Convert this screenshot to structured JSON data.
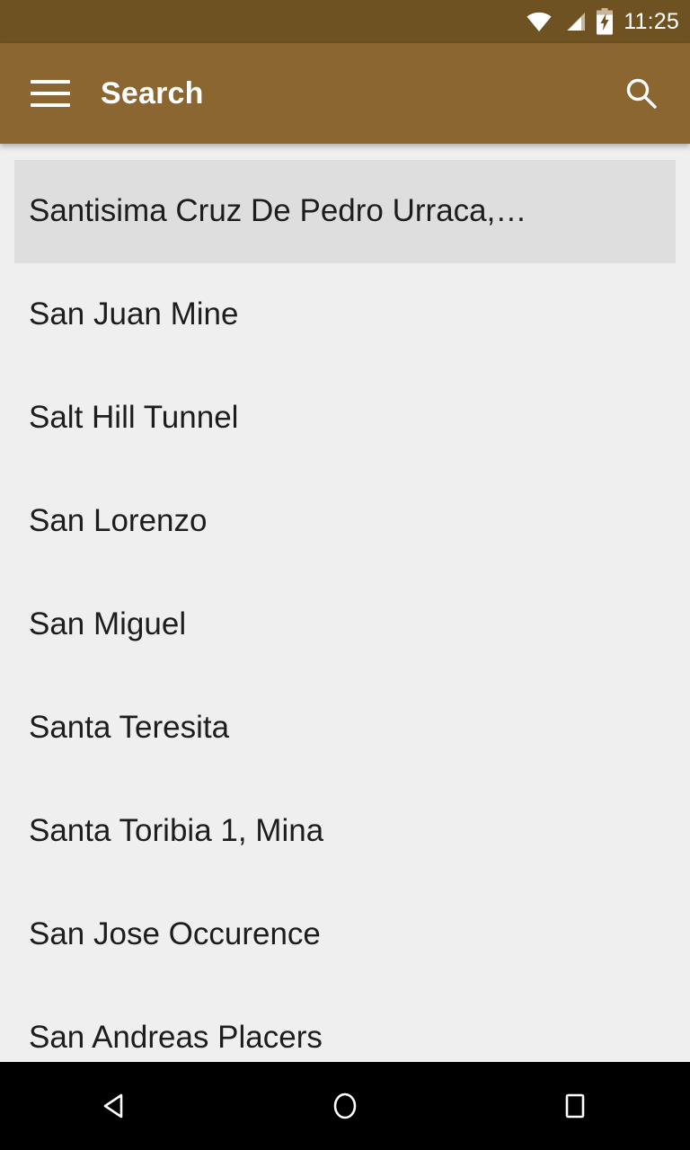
{
  "status_bar": {
    "time": "11:25",
    "icons": [
      {
        "name": "wifi-icon",
        "label": "wifi"
      },
      {
        "name": "cell-signal-icon",
        "label": "signal"
      },
      {
        "name": "battery-charging-icon",
        "label": "battery charging"
      }
    ],
    "background_color": "#6E5222"
  },
  "app_bar": {
    "menu_icon": "hamburger-menu-icon",
    "title": "Search",
    "search_icon": "search-icon",
    "background_color": "#8C6630",
    "text_color": "#FFFFFF"
  },
  "list": {
    "background_color": "#EFEFEF",
    "selected_color": "#DEDEDE",
    "text_color": "#1D1D1D",
    "items": [
      {
        "label": "Santisima Cruz De Pedro Urraca,…",
        "selected": true
      },
      {
        "label": "San Juan Mine",
        "selected": false
      },
      {
        "label": "Salt Hill Tunnel",
        "selected": false
      },
      {
        "label": "San Lorenzo",
        "selected": false
      },
      {
        "label": "San Miguel",
        "selected": false
      },
      {
        "label": "Santa Teresita",
        "selected": false
      },
      {
        "label": "Santa Toribia 1, Mina",
        "selected": false
      },
      {
        "label": "San Jose Occurence",
        "selected": false
      },
      {
        "label": "San Andreas Placers",
        "selected": false
      }
    ]
  },
  "nav_bar": {
    "background_color": "#000000",
    "buttons": [
      {
        "name": "back-button",
        "icon": "back-triangle-icon"
      },
      {
        "name": "home-button",
        "icon": "home-circle-icon"
      },
      {
        "name": "recents-button",
        "icon": "recents-square-icon"
      }
    ]
  }
}
